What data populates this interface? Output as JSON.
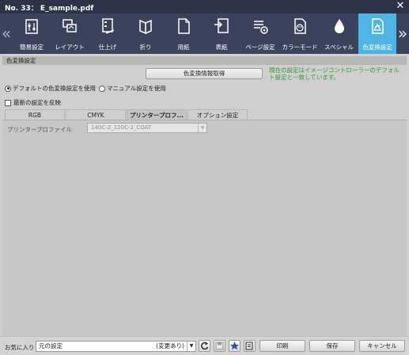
{
  "window": {
    "title": "No. 33： E_sample.pdf",
    "close_glyph": "✕"
  },
  "nav": {
    "prev_glyph": "«",
    "next_glyph": "»"
  },
  "tabs": [
    {
      "label": "簡易設定",
      "icon": "quick-settings-icon"
    },
    {
      "label": "レイアウト",
      "icon": "layout-icon"
    },
    {
      "label": "仕上げ",
      "icon": "finishing-icon"
    },
    {
      "label": "折り",
      "icon": "fold-icon"
    },
    {
      "label": "用紙",
      "icon": "paper-icon"
    },
    {
      "label": "表紙",
      "icon": "cover-icon"
    },
    {
      "label": "ページ設定",
      "icon": "page-settings-icon"
    },
    {
      "label": "カラーモード",
      "icon": "color-mode-icon"
    },
    {
      "label": "スペシャル",
      "icon": "special-icon"
    },
    {
      "label": "色変換設定",
      "icon": "color-conversion-icon",
      "active": true
    }
  ],
  "panel": {
    "section_title": "色変換設定",
    "info_button": "色変換情報取得",
    "status_note": "現在の設定はイメージコントローラーのデフォルト設定と一致しています。",
    "radio_default": "デフォルトの色変換設定を使用",
    "radio_manual": "マニュアル設定を使用",
    "selected_radio": "default",
    "reflect_latest": "最新の設定を反映",
    "subtabs": [
      "RGB",
      "CMYK",
      "プリンタープロフ...",
      "オプション設定"
    ],
    "active_subtab": 2,
    "profile_label": "プリンタープロファイル",
    "profile_value": "140C-2_120C-2_COAT"
  },
  "bottom": {
    "favorites_label": "お気に入り",
    "favorites_value": "元の設定",
    "favorites_changed": "(変更あり)",
    "print_button": "印刷",
    "save_button": "保存",
    "cancel_button": "キャンセル"
  },
  "colors": {
    "titlebar": "#2b3346",
    "tabbar": "#39445c",
    "active_tab": "#4fb3e3",
    "status_note": "#2f9b2f"
  }
}
